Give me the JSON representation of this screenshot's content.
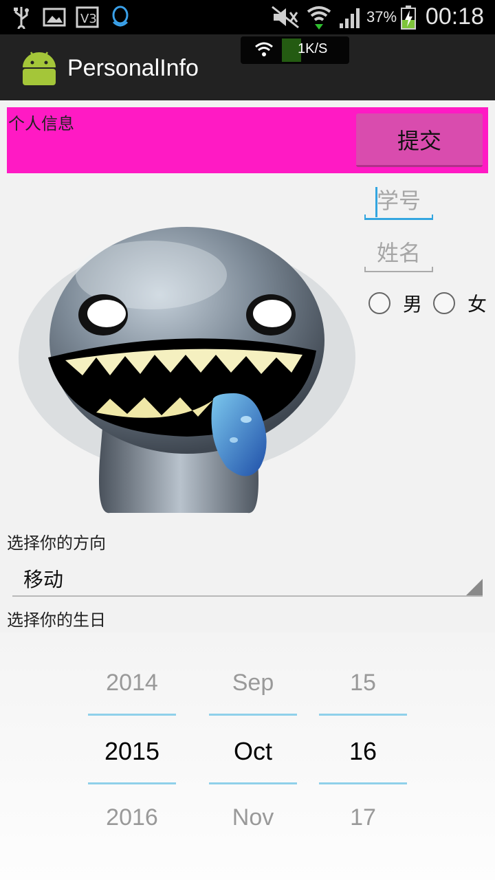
{
  "status_bar": {
    "battery_percent": "37%",
    "time": "00:18",
    "net_speed": "1K/S",
    "icons": [
      "usb-icon",
      "image-icon",
      "v3-icon",
      "qq-icon",
      "mute-icon",
      "wifi-icon",
      "signal-icon",
      "battery-icon"
    ]
  },
  "action_bar": {
    "title": "PersonalInfo",
    "app_icon": "android-icon"
  },
  "header": {
    "label": "个人信息",
    "submit_label": "提交",
    "background": "#ff1ac4",
    "submit_color": "#d94cae"
  },
  "form": {
    "student_id_placeholder": "学号",
    "student_id_value": "",
    "name_placeholder": "姓名",
    "name_value": "",
    "gender_options": [
      "男",
      "女"
    ]
  },
  "direction": {
    "label": "选择你的方向",
    "selected": "移动"
  },
  "birthday": {
    "label": "选择你的生日",
    "year": {
      "prev": "2014",
      "current": "2015",
      "next": "2016"
    },
    "month": {
      "prev": "Sep",
      "current": "Oct",
      "next": "Nov"
    },
    "day": {
      "prev": "15",
      "current": "16",
      "next": "17"
    }
  },
  "colors": {
    "accent": "#33a6e0",
    "picker_divider": "#8fd0ea"
  }
}
